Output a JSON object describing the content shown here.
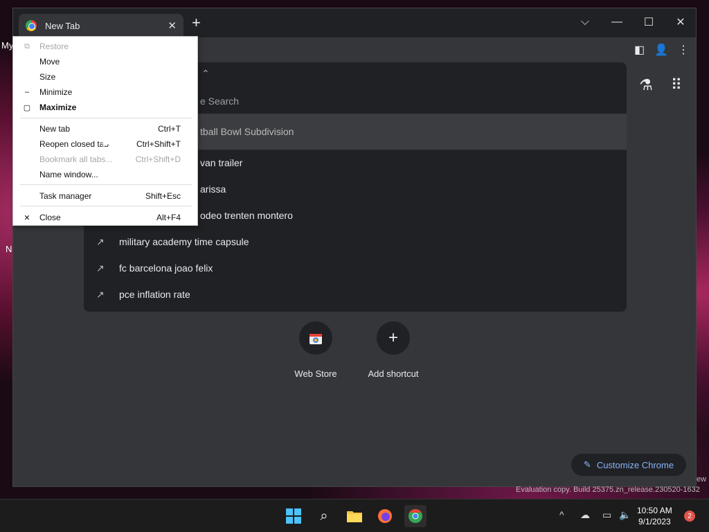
{
  "desktop": {
    "frag1": "My",
    "frag2": "N",
    "frag3": "ew"
  },
  "tab": {
    "title": "New Tab",
    "favicon": "chrome-icon",
    "close_glyph": "✕"
  },
  "new_tab_glyph": "+",
  "window_controls": {
    "dropdown": "⌵",
    "minimize": "—",
    "maximize": "☐",
    "close": "✕"
  },
  "search": {
    "header_partial": "e Search",
    "selected_partial": "tball Bowl Subdivision",
    "rows": [
      {
        "text": "van trailer",
        "icon": "trending-icon"
      },
      {
        "text": "arissa",
        "icon": "trending-icon"
      },
      {
        "text": "odeo trenten montero",
        "icon": "trending-icon"
      },
      {
        "text": "military academy time capsule",
        "icon": "trending-icon"
      },
      {
        "text": "fc barcelona joao felix",
        "icon": "trending-icon"
      },
      {
        "text": "pce inflation rate",
        "icon": "trending-icon"
      }
    ]
  },
  "shortcuts": [
    {
      "label": "Web Store"
    },
    {
      "label": "Add shortcut",
      "glyph": "+"
    }
  ],
  "customize": {
    "label": "Customize Chrome",
    "icon": "✎"
  },
  "menu": {
    "items": [
      {
        "label": "Restore",
        "icon": "⧉",
        "shortcut": ""
      },
      {
        "label": "Move",
        "icon": "",
        "shortcut": ""
      },
      {
        "label": "Size",
        "icon": "",
        "shortcut": ""
      },
      {
        "label": "Minimize",
        "icon": "–",
        "shortcut": ""
      },
      {
        "label": "Maximize",
        "icon": "▢",
        "shortcut": ""
      },
      {
        "label": "New tab",
        "icon": "",
        "shortcut": "Ctrl+T"
      },
      {
        "label": "Reopen closed tab",
        "icon": "",
        "shortcut": "Ctrl+Shift+T"
      },
      {
        "label": "Bookmark all tabs...",
        "icon": "",
        "shortcut": "Ctrl+Shift+D"
      },
      {
        "label": "Name window...",
        "icon": "",
        "shortcut": ""
      },
      {
        "label": "Task manager",
        "icon": "",
        "shortcut": "Shift+Esc"
      },
      {
        "label": "Close",
        "icon": "✕",
        "shortcut": "Alt+F4"
      }
    ]
  },
  "watermark": "Evaluation copy. Build 25375.zn_release.230520-1632",
  "taskbar": {
    "clock_time": "10:50 AM",
    "clock_date": "9/1/2023",
    "notifications": "2",
    "tray_up": "^"
  }
}
